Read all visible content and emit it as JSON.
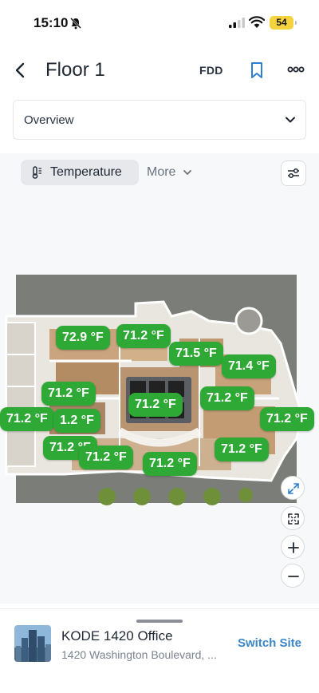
{
  "status_bar": {
    "time": "15:10",
    "battery": "54"
  },
  "header": {
    "title": "Floor 1",
    "fdd_label": "FDD"
  },
  "view_select": {
    "value": "Overview"
  },
  "toolbar": {
    "metric_label": "Temperature",
    "more_label": "More"
  },
  "temperatures": [
    "72.9 °F",
    "71.2 °F",
    "71.5 °F",
    "71.4 °F",
    "71.2 °F",
    "71.2 °F",
    "71.2 °F",
    "71.2 °F",
    "1.2 °F",
    "71.2 °F",
    "71.2 °F",
    "71.2 °F",
    "71.2 °F",
    "71.2 °F"
  ],
  "site": {
    "name": "KODE 1420 Office",
    "address": "1420 Washington Boulevard, ...",
    "switch_label": "Switch Site"
  },
  "colors": {
    "accent_green": "#2fa935",
    "link_blue": "#3b86c6"
  }
}
